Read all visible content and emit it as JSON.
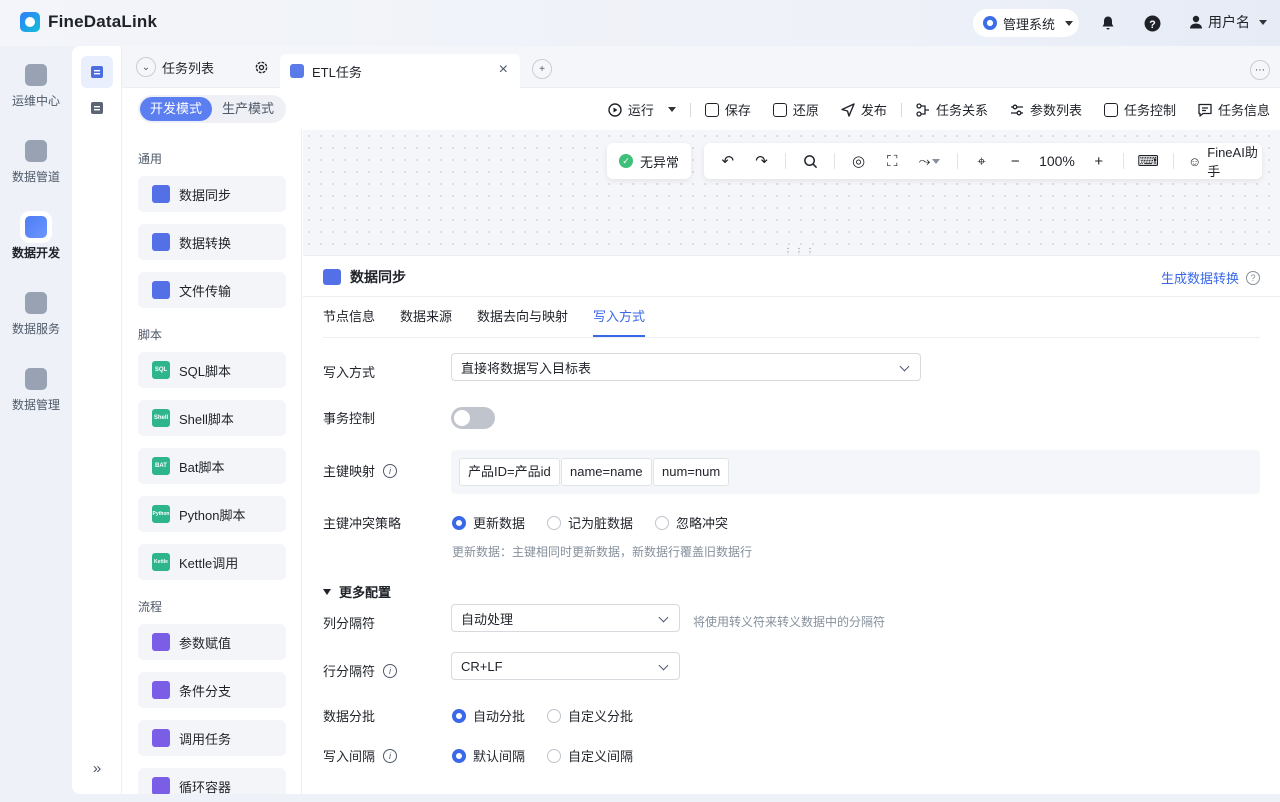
{
  "app": {
    "title": "FineDataLink"
  },
  "header": {
    "system_label": "管理系统",
    "user_label": "用户名"
  },
  "leftnav": [
    {
      "label": "运维中心"
    },
    {
      "label": "数据管道"
    },
    {
      "label": "数据开发"
    },
    {
      "label": "数据服务"
    },
    {
      "label": "数据管理"
    }
  ],
  "tabs": {
    "list_label": "任务列表",
    "active_tab": "ETL任务"
  },
  "mode": {
    "dev": "开发模式",
    "prod": "生产模式"
  },
  "toolbar": {
    "run": "运行",
    "save": "保存",
    "restore": "还原",
    "publish": "发布",
    "relations": "任务关系",
    "params": "参数列表",
    "control": "任务控制",
    "info": "任务信息"
  },
  "palette": {
    "sections": [
      "通用",
      "脚本",
      "流程"
    ],
    "general": [
      "数据同步",
      "数据转换",
      "文件传输"
    ],
    "scripts": [
      {
        "label": "SQL脚本",
        "badge": "SQL"
      },
      {
        "label": "Shell脚本",
        "badge": "Shell"
      },
      {
        "label": "Bat脚本",
        "badge": "BAT"
      },
      {
        "label": "Python脚本",
        "badge": "Python"
      },
      {
        "label": "Kettle调用",
        "badge": "Kettle"
      }
    ],
    "flow": [
      "参数赋值",
      "条件分支",
      "调用任务",
      "循环容器"
    ]
  },
  "canvas": {
    "status": "无异常",
    "zoom": "100%",
    "ai_label": "FineAI助手"
  },
  "panel": {
    "title": "数据同步",
    "generate_link": "生成数据转换",
    "tabs": [
      "节点信息",
      "数据来源",
      "数据去向与映射",
      "写入方式"
    ],
    "write_mode_label": "写入方式",
    "write_mode_value": "直接将数据写入目标表",
    "txn_label": "事务控制",
    "txn_on": false,
    "pk_label": "主键映射",
    "pk_chips": [
      "产品ID=产品id",
      "name=name",
      "num=num"
    ],
    "conflict_label": "主键冲突策略",
    "conflict_options": [
      "更新数据",
      "记为脏数据",
      "忽略冲突"
    ],
    "conflict_hint": "更新数据：主键相同时更新数据，新数据行覆盖旧数据行",
    "more_config": "更多配置",
    "col_sep_label": "列分隔符",
    "col_sep_value": "自动处理",
    "col_sep_hint": "将使用转义符来转义数据中的分隔符",
    "row_sep_label": "行分隔符",
    "row_sep_value": "CR+LF",
    "batch_label": "数据分批",
    "batch_options": [
      "自动分批",
      "自定义分批"
    ],
    "interval_label": "写入间隔",
    "interval_options": [
      "默认间隔",
      "自定义间隔"
    ]
  },
  "colors": {
    "accent": "#3a68e8",
    "mode_active": "#5b7ef0",
    "ok": "#3ebf7a"
  }
}
